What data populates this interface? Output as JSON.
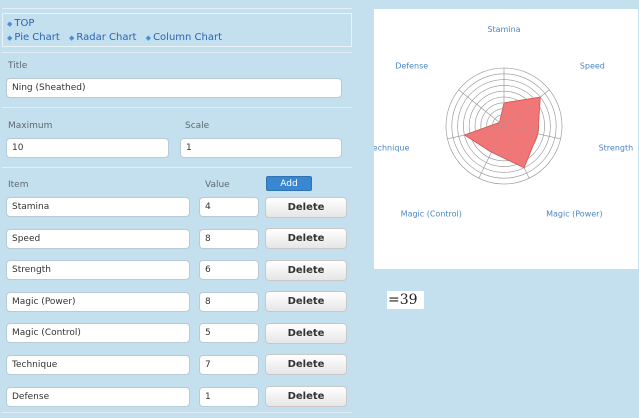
{
  "nav": {
    "row1": [
      {
        "label": "TOP"
      }
    ],
    "row2": [
      {
        "label": "Pie Chart"
      },
      {
        "label": "Radar Chart"
      },
      {
        "label": "Column Chart"
      }
    ]
  },
  "form": {
    "title_label": "Title",
    "title_value": "Ning (Sheathed)",
    "maximum_label": "Maximum",
    "maximum_value": "10",
    "scale_label": "Scale",
    "scale_value": "1",
    "item_header": "Item",
    "value_header": "Value",
    "add_label": "Add",
    "delete_label": "Delete",
    "items": [
      {
        "name": "Stamina",
        "value": "4"
      },
      {
        "name": "Speed",
        "value": "8"
      },
      {
        "name": "Strength",
        "value": "6"
      },
      {
        "name": "Magic (Power)",
        "value": "8"
      },
      {
        "name": "Magic (Control)",
        "value": "5"
      },
      {
        "name": "Technique",
        "value": "7"
      },
      {
        "name": "Defense",
        "value": "1"
      }
    ]
  },
  "chart_data": {
    "type": "radar",
    "axes": [
      "Stamina",
      "Speed",
      "Strength",
      "Magic (Power)",
      "Magic (Control)",
      "Technique",
      "Defense"
    ],
    "values": [
      4,
      8,
      6,
      8,
      5,
      7,
      1
    ],
    "max": 10,
    "scale": 1,
    "fill_color": "#f47575",
    "grid_color": "#999999",
    "label_color": "#4a86c6"
  },
  "total": "=39"
}
